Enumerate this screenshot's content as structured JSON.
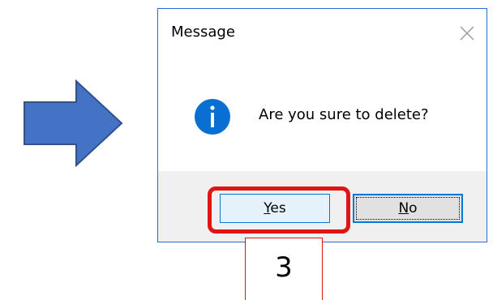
{
  "dialog": {
    "title": "Message",
    "message": "Are you sure to delete?",
    "icon": "info-icon",
    "buttons": {
      "yes": {
        "label_underlined": "Y",
        "label_rest": "es"
      },
      "no": {
        "label_underlined": "N",
        "label_rest": "o"
      }
    },
    "close_icon": "close-icon"
  },
  "annotation": {
    "step_number": "3",
    "highlight_color": "#e01414",
    "arrow_color": "#4472c4"
  },
  "colors": {
    "accent": "#0078d7",
    "info_icon": "#0a6fd3",
    "footer_bg": "#f0f0f0"
  }
}
